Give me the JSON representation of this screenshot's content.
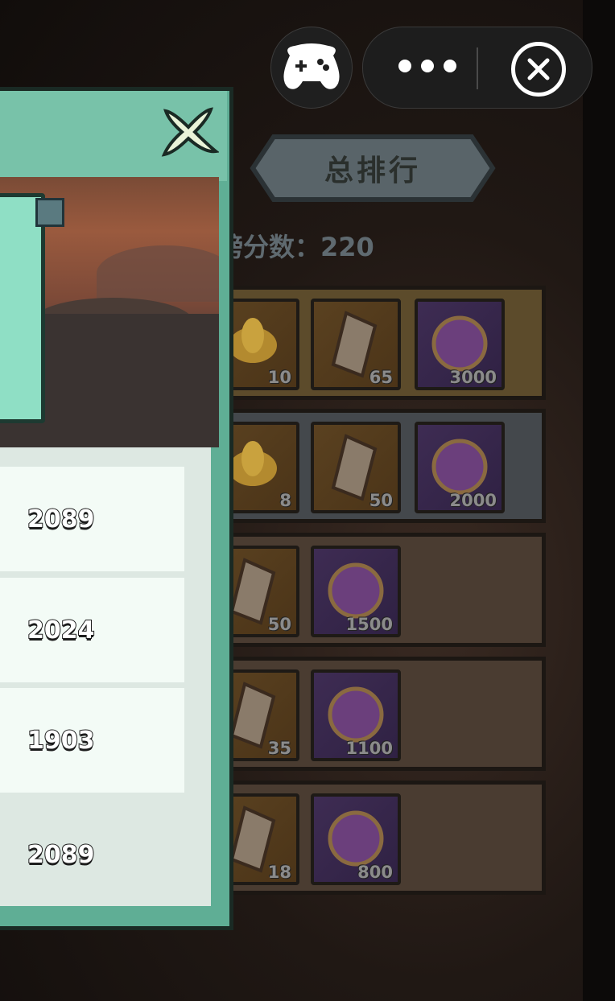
{
  "capsule": {
    "gamepad_icon": "gamepad-icon",
    "more_icon": "more-dots-icon",
    "close_icon": "close-circle-icon"
  },
  "board": {
    "tab_total_label": "总排行",
    "score_line": "榜分数：220",
    "reward_rows": [
      {
        "items": [
          {
            "type": "lotus",
            "qty": "10"
          },
          {
            "type": "talisman",
            "qty": "65"
          },
          {
            "type": "orb",
            "qty": "3000"
          }
        ]
      },
      {
        "items": [
          {
            "type": "lotus",
            "qty": "8"
          },
          {
            "type": "talisman",
            "qty": "50"
          },
          {
            "type": "orb",
            "qty": "2000"
          }
        ]
      },
      {
        "items": [
          {
            "type": "talisman",
            "qty": "50"
          },
          {
            "type": "orb",
            "qty": "1500"
          }
        ]
      },
      {
        "items": [
          {
            "type": "talisman",
            "qty": "35"
          },
          {
            "type": "orb",
            "qty": "1100"
          }
        ]
      },
      {
        "items": [
          {
            "type": "talisman",
            "qty": "18"
          },
          {
            "type": "orb",
            "qty": "800"
          }
        ]
      }
    ]
  },
  "panel": {
    "close_icon": "close-x-icon",
    "scores": [
      "2089",
      "2024",
      "1903",
      "2089"
    ]
  },
  "colors": {
    "panel_green": "#5fae95",
    "panel_light": "#dde8e2",
    "row_white": "#f3fbf6"
  }
}
